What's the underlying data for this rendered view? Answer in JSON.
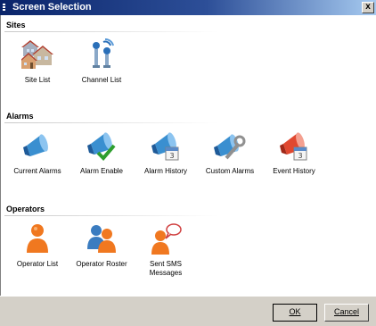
{
  "window": {
    "title": "Screen Selection",
    "close_label": "x"
  },
  "sections": {
    "sites": {
      "header": "Sites",
      "items": [
        {
          "label": "Site List",
          "icon": "houses-icon"
        },
        {
          "label": "Channel List",
          "icon": "antenna-icon"
        }
      ]
    },
    "alarms": {
      "header": "Alarms",
      "items": [
        {
          "label": "Current Alarms",
          "icon": "siren-icon"
        },
        {
          "label": "Alarm Enable",
          "icon": "siren-check-icon"
        },
        {
          "label": "Alarm History",
          "icon": "siren-calendar-icon"
        },
        {
          "label": "Custom Alarms",
          "icon": "siren-wrench-icon"
        },
        {
          "label": "Event History",
          "icon": "siren-calendar-red-icon"
        }
      ]
    },
    "operators": {
      "header": "Operators",
      "items": [
        {
          "label": "Operator List",
          "icon": "person-icon"
        },
        {
          "label": "Operator Roster",
          "icon": "people-icon"
        },
        {
          "label": "Sent SMS Messages",
          "icon": "person-speech-icon"
        }
      ]
    }
  },
  "buttons": {
    "ok": "OK",
    "cancel": "Cancel"
  },
  "colors": {
    "title_start": "#0a246a",
    "title_end": "#a6caf0",
    "face": "#d4d0c8",
    "siren": "#3a8fd0",
    "operator": "#f07820"
  }
}
